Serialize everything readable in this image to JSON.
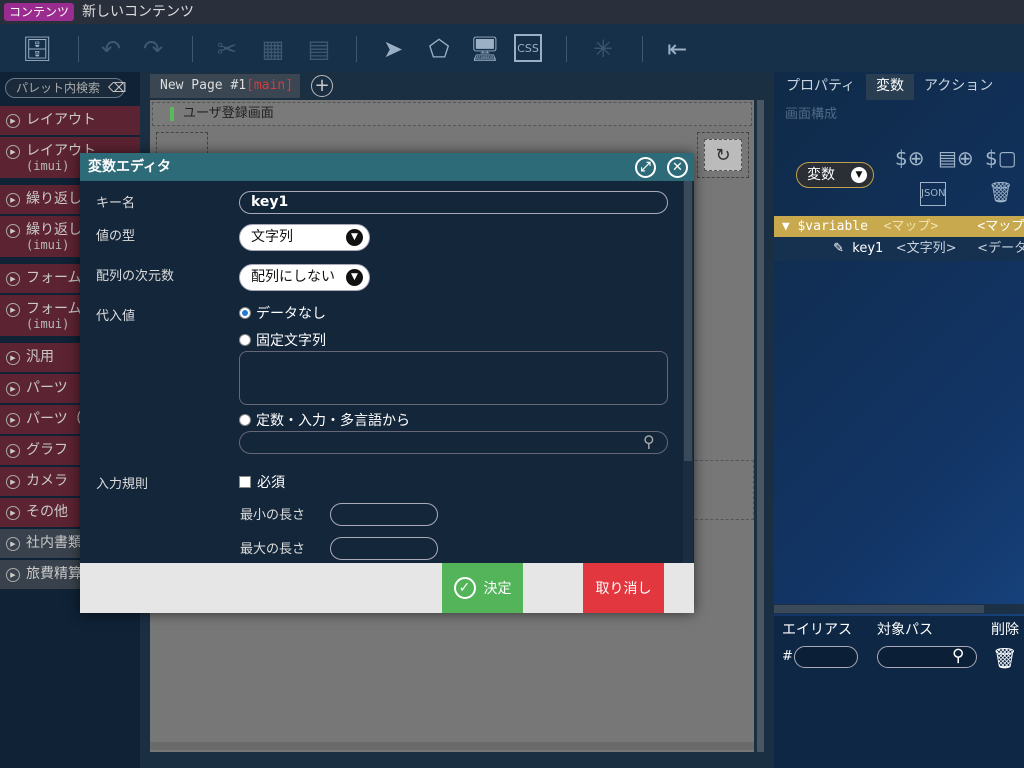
{
  "titlebar": {
    "badge": "コンテンツ",
    "page_name": "新しいコンテンツ"
  },
  "palette": {
    "search_placeholder": "パレット内検索",
    "items": [
      {
        "label": "レイアウト",
        "sub": ""
      },
      {
        "label": "レイアウト",
        "sub": "(imui)"
      },
      {
        "label": "繰り返し",
        "sub": ""
      },
      {
        "label": "繰り返し",
        "sub": "(imui)"
      },
      {
        "label": "フォーム",
        "sub": ""
      },
      {
        "label": "フォーム",
        "sub": "(imui)"
      },
      {
        "label": "汎用",
        "sub": ""
      },
      {
        "label": "パーツ",
        "sub": ""
      },
      {
        "label": "パーツ（",
        "sub": ""
      },
      {
        "label": "グラフ",
        "sub": ""
      },
      {
        "label": "カメラ",
        "sub": ""
      },
      {
        "label": "その他",
        "sub": ""
      },
      {
        "label": "社内書類",
        "sub": ""
      },
      {
        "label": "旅費精算",
        "sub": ""
      }
    ]
  },
  "canvas": {
    "tab_label": "New Page #1",
    "tab_main": "[main]",
    "header_text": "ユーザ登録画面"
  },
  "right_panel": {
    "tabs": [
      "プロパティ",
      "変数",
      "アクション"
    ],
    "sub_tab": "画面構成",
    "var_type": "変数",
    "var_head": {
      "name": "$variable",
      "type": "<マップ>",
      "type2": "<マップ>"
    },
    "var_child": {
      "name": "key1",
      "type": "<文字列>",
      "type2": "<データ"
    },
    "alias_headers": [
      "エイリアス",
      "対象パス",
      "削除"
    ],
    "alias_hash": "#"
  },
  "dialog": {
    "title": "変数エディタ",
    "labels": {
      "key": "キー名",
      "value_type": "値の型",
      "dims": "配列の次元数",
      "assign": "代入値",
      "rules": "入力規則",
      "min_len": "最小の長さ",
      "max_len": "最大の長さ"
    },
    "key_value": "key1",
    "value_type_selected": "文字列",
    "dims_selected": "配列にしない",
    "radios": {
      "none": "データなし",
      "fixed": "固定文字列",
      "const": "定数・入力・多言語から"
    },
    "required_label": "必須",
    "ok_label": "決定",
    "cancel_label": "取り消し"
  }
}
